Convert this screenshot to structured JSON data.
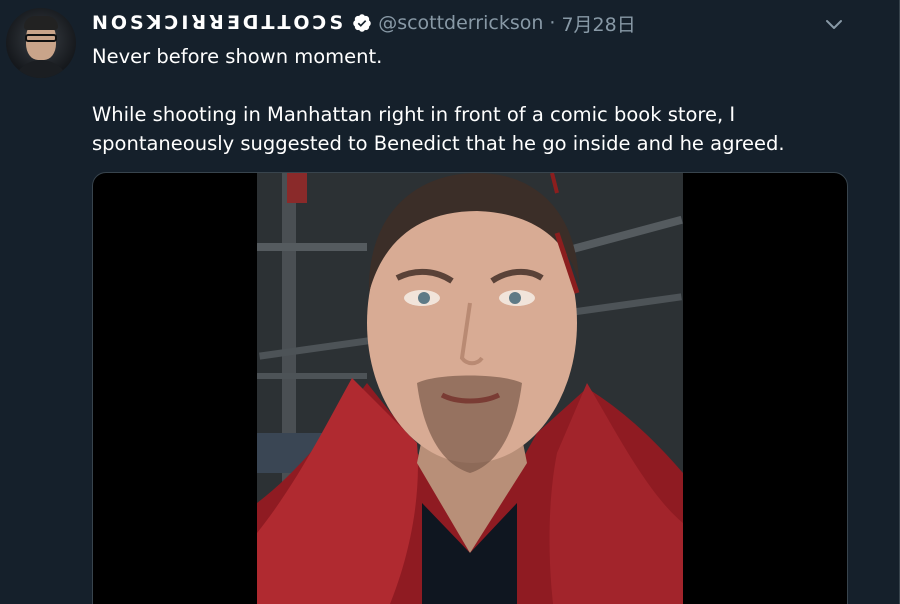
{
  "tweet": {
    "display_name": "NOSꓘƆIꓤꓤƎꓷꓕꓕOƆS",
    "handle": "@scottderrickson",
    "separator": "·",
    "date": "7月28日",
    "text": "Never before shown moment.\n\nWhile shooting in Manhattan right in front of a comic book store, I spontaneously suggested to Benedict that he go inside and he agreed."
  },
  "icons": {
    "verified": "verified-badge-icon",
    "caret": "chevron-down-icon"
  },
  "colors": {
    "background": "#15202b",
    "secondary_text": "#8899a6",
    "border": "#38444d",
    "verified_fill": "#ffffff"
  }
}
